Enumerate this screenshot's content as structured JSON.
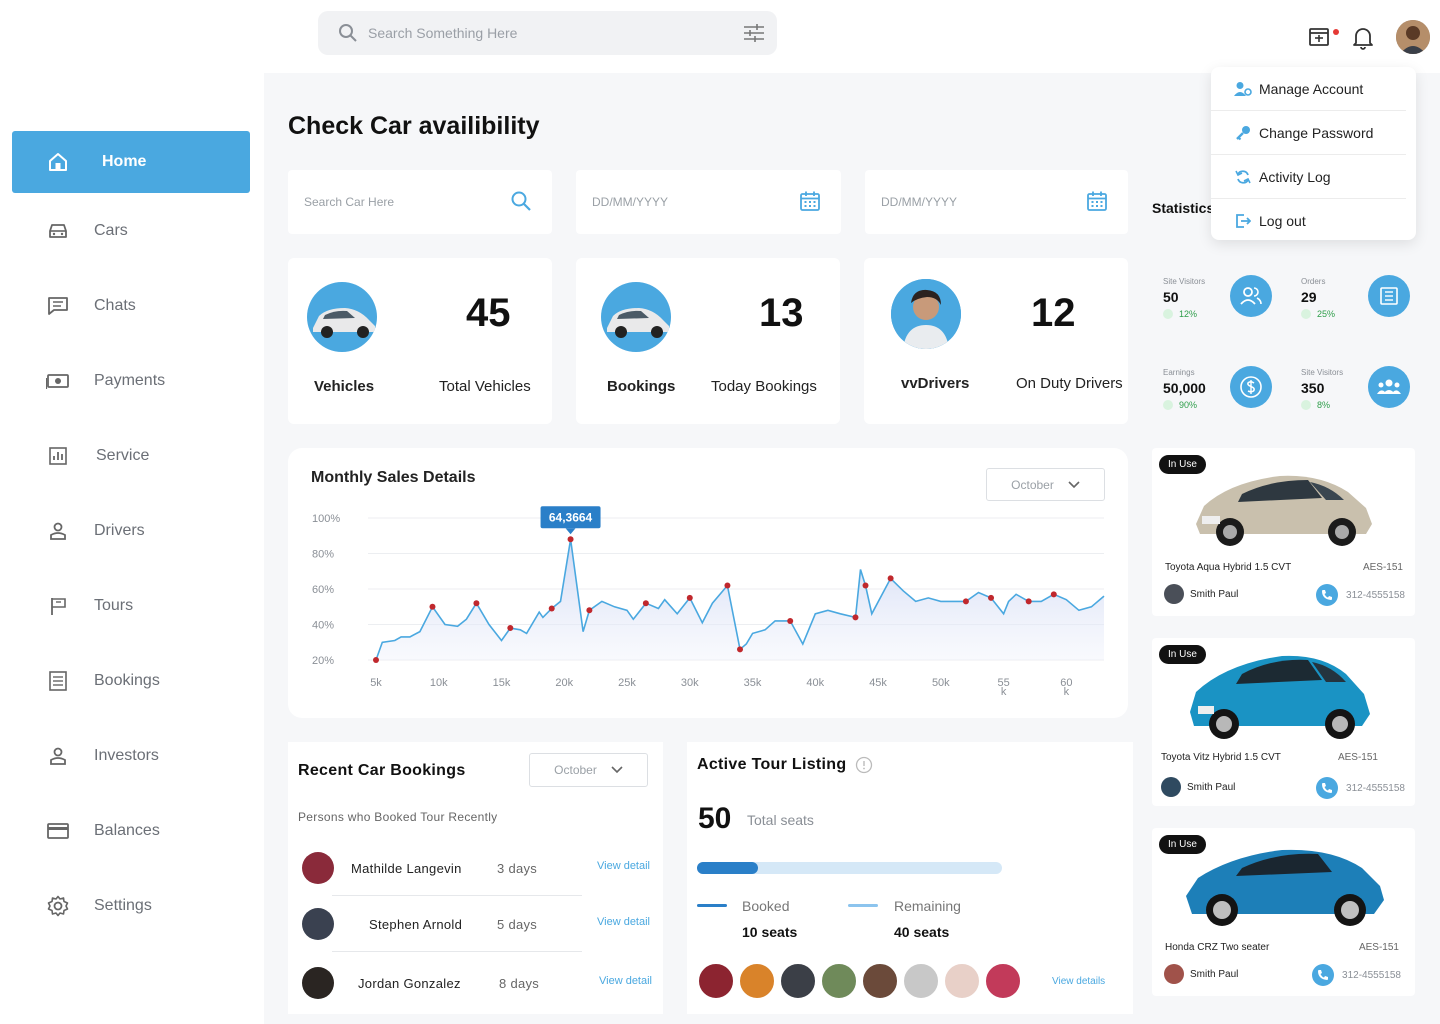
{
  "search": {
    "placeholder": "Search Something Here"
  },
  "sidebar": {
    "items": [
      {
        "label": "Home",
        "icon": "home-icon"
      },
      {
        "label": "Cars",
        "icon": "car-icon"
      },
      {
        "label": "Chats",
        "icon": "chat-icon"
      },
      {
        "label": "Payments",
        "icon": "payments-icon"
      },
      {
        "label": "Service",
        "icon": "service-icon"
      },
      {
        "label": "Drivers",
        "icon": "user-icon"
      },
      {
        "label": "Tours",
        "icon": "flag-icon"
      },
      {
        "label": "Bookings",
        "icon": "list-icon"
      },
      {
        "label": "Investors",
        "icon": "user-icon"
      },
      {
        "label": "Balances",
        "icon": "card-icon"
      },
      {
        "label": "Settings",
        "icon": "gear-icon"
      }
    ]
  },
  "page": {
    "title": "Check Car availibility"
  },
  "filters": {
    "car_search_placeholder": "Search Car Here",
    "date_from_placeholder": "DD/MM/YYYY",
    "date_to_placeholder": "DD/MM/YYYY"
  },
  "stats_cards": [
    {
      "name": "Vehicles",
      "value": "45",
      "label": "Total Vehicles"
    },
    {
      "name": "Bookings",
      "value": "13",
      "label": "Today Bookings"
    },
    {
      "name": "vvDrivers",
      "value": "12",
      "label": "On Duty Drivers"
    }
  ],
  "statistics": {
    "heading": "Statistics",
    "items": [
      {
        "title": "Site Visitors",
        "value": "50",
        "change": "12%",
        "icon": "users-icon"
      },
      {
        "title": "Orders",
        "value": "29",
        "change": "25%",
        "icon": "orders-icon"
      },
      {
        "title": "Earnings",
        "value": "50,000",
        "change": "90%",
        "icon": "dollar-icon"
      },
      {
        "title": "Site Visitors",
        "value": "350",
        "change": "8%",
        "icon": "group-icon"
      }
    ]
  },
  "chart_data": {
    "type": "area",
    "title": "Monthly Sales Details",
    "filter": "October",
    "x_ticks": [
      "5k",
      "10k",
      "15k",
      "20k",
      "25k",
      "30k",
      "35k",
      "40k",
      "45k",
      "50k",
      "55\nk",
      "60\nk"
    ],
    "y_ticks": [
      "100%",
      "80%",
      "60%",
      "40%",
      "20%"
    ],
    "ylim": [
      20,
      100
    ],
    "x": [
      5,
      5.5,
      6.5,
      7,
      7.7,
      8.5,
      9.5,
      10.5,
      11.5,
      12.2,
      13,
      14,
      15,
      15.7,
      16.5,
      17,
      18,
      18.3,
      19,
      19.7,
      20.5,
      21.5,
      22,
      23,
      24,
      25,
      25.5,
      26.5,
      27.5,
      28,
      29,
      30,
      31,
      31.8,
      33,
      34,
      34.5,
      35,
      36,
      36.8,
      38,
      39,
      40,
      41,
      42,
      43.2,
      43.6,
      44,
      44.5,
      46,
      47,
      48,
      49,
      50,
      51,
      52,
      53,
      54,
      55,
      55.4,
      56,
      57,
      58,
      59,
      60,
      61,
      62,
      63
    ],
    "values": [
      20,
      30,
      31,
      33,
      33,
      36,
      50,
      40,
      39,
      43,
      52,
      40,
      31,
      38,
      37,
      35,
      47,
      44,
      49,
      53,
      88,
      36,
      48,
      53,
      50,
      48,
      43,
      52,
      49,
      54,
      46,
      55,
      41,
      52,
      62,
      26,
      29,
      35,
      37,
      42,
      42,
      29,
      46,
      48,
      46,
      44,
      71,
      62,
      46,
      66,
      59,
      53,
      55,
      53,
      53,
      53,
      58,
      55,
      46,
      53,
      57,
      53,
      53,
      57,
      54,
      48,
      50,
      56
    ],
    "highlight_index": 20,
    "highlight_label": "64,3664",
    "marked_indices": [
      0,
      6,
      10,
      13,
      18,
      20,
      22,
      27,
      31,
      34,
      35,
      40,
      45,
      47,
      49,
      55,
      57,
      61,
      63
    ]
  },
  "bookings": {
    "title": "Recent Car Bookings",
    "filter": "October",
    "subtitle": "Persons who Booked Tour Recently",
    "rows": [
      {
        "name": "Mathilde Langevin",
        "days": "3 days",
        "link": "View detail",
        "avatar_color": "#8a2a3a"
      },
      {
        "name": "Stephen Arnold",
        "days": "5 days",
        "link": "View detail",
        "avatar_color": "#3a4150"
      },
      {
        "name": "Jordan Gonzalez",
        "days": "8 days",
        "link": "View detail",
        "avatar_color": "#2a2522"
      }
    ]
  },
  "tour": {
    "title": "Active Tour Listing",
    "total": "50",
    "total_label": "Total seats",
    "booked_fraction": 0.2,
    "booked_label": "Booked",
    "booked_value": "10 seats",
    "remaining_label": "Remaining",
    "remaining_value": "40 seats",
    "link": "View details",
    "avatar_colors": [
      "#8c2430",
      "#d9832a",
      "#3b3f47",
      "#6f8a5a",
      "#6b4a3a",
      "#c8c8c8",
      "#e8d0c8",
      "#c23a5a"
    ]
  },
  "cars": [
    {
      "status": "In Use",
      "model": "Toyota Aqua Hybrid 1.5 CVT",
      "plate": "AES-151",
      "driver": "Smith Paul",
      "phone": "312-4555158",
      "color": "#c9c0ad"
    },
    {
      "status": "In Use",
      "model": "Toyota Vitz Hybrid 1.5 CVT",
      "plate": "AES-151",
      "driver": "Smith Paul",
      "phone": "312-4555158",
      "color": "#1a93c4"
    },
    {
      "status": "In Use",
      "model": "Honda CRZ Two seater",
      "plate": "AES-151",
      "driver": "Smith Paul",
      "phone": "312-4555158",
      "color": "#1d7fb8"
    }
  ],
  "account_menu": {
    "items": [
      {
        "label": "Manage Account",
        "icon": "manage-account-icon"
      },
      {
        "label": "Change Password",
        "icon": "key-icon"
      },
      {
        "label": "Activity Log",
        "icon": "refresh-icon"
      },
      {
        "label": "Log out",
        "icon": "logout-icon"
      }
    ]
  },
  "colors": {
    "accent": "#4aa8e0",
    "chart_line": "#4aa8e0",
    "marker": "#c0282d",
    "text": "#111111"
  }
}
